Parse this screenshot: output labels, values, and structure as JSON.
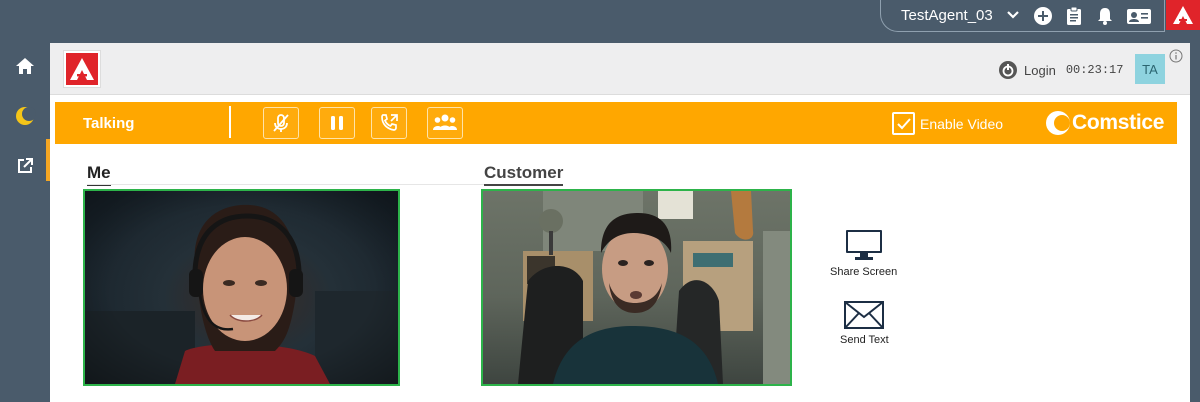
{
  "topbar": {
    "agent_name": "TestAgent_03",
    "icons": [
      "chevron-down-icon",
      "add-circle-icon",
      "clipboard-icon",
      "bell-icon",
      "contact-card-icon"
    ]
  },
  "sidenav": {
    "items": [
      "home-icon",
      "moon-icon",
      "external-link-icon"
    ]
  },
  "header": {
    "login_label": "Login",
    "login_timer": "00:23:17",
    "avatar_initials": "TA"
  },
  "status": {
    "state": "Talking",
    "controls": [
      "mute-icon",
      "pause-icon",
      "transfer-call-icon",
      "conference-icon"
    ],
    "enable_video_label": "Enable Video",
    "enable_video_checked": true,
    "brand": "Comstice"
  },
  "video": {
    "me_label": "Me",
    "customer_label": "Customer"
  },
  "actions": {
    "share_screen": "Share Screen",
    "send_text": "Send Text"
  },
  "colors": {
    "accent": "#ffa700",
    "brand_red": "#e0242a",
    "video_border": "#2db34a",
    "nav_bg": "#4a5b6b"
  }
}
